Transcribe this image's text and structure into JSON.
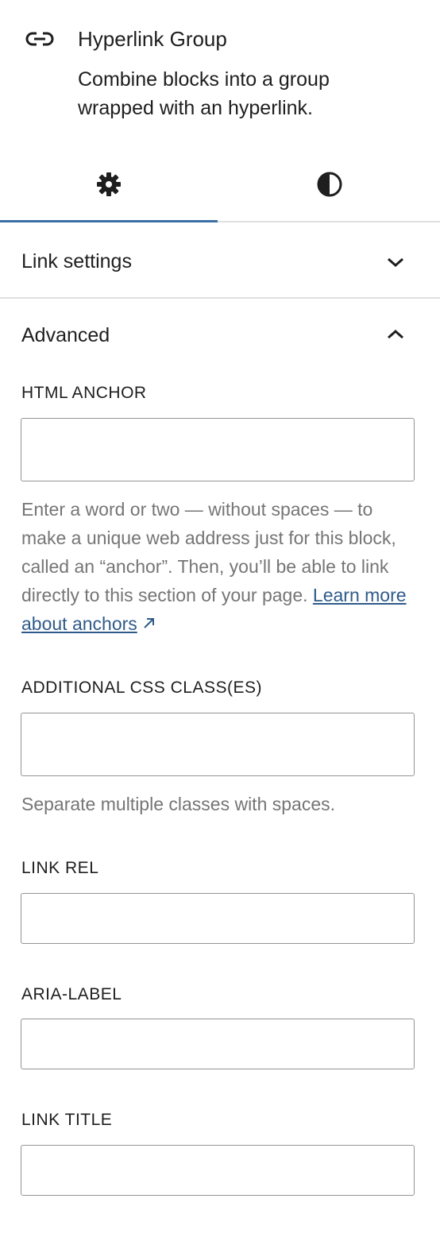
{
  "block": {
    "icon": "link-icon",
    "title": "Hyperlink Group",
    "description": "Combine blocks into a group wrapped with an hyperlink."
  },
  "tabs": [
    {
      "icon": "gear-icon",
      "selected": true
    },
    {
      "icon": "contrast-icon",
      "selected": false
    }
  ],
  "panels": {
    "link_settings": {
      "title": "Link settings",
      "expanded": false
    },
    "advanced": {
      "title": "Advanced",
      "expanded": true
    }
  },
  "fields": {
    "html_anchor": {
      "label": "HTML ANCHOR",
      "value": "",
      "help_prefix": "Enter a word or two — without spaces — to make a unique web address just for this block, called an “anchor”. Then, you’ll be able to link directly to this section of your page. ",
      "help_link": "Learn more about anchors"
    },
    "additional_css": {
      "label": "ADDITIONAL CSS CLASS(ES)",
      "value": "",
      "help": "Separate multiple classes with spaces."
    },
    "link_rel": {
      "label": "LINK REL",
      "value": ""
    },
    "aria_label": {
      "label": "ARIA-LABEL",
      "value": ""
    },
    "link_title": {
      "label": "LINK TITLE",
      "value": ""
    }
  },
  "colors": {
    "accent": "#3a6ea5",
    "link": "#2f5b8a",
    "help_text": "#757575"
  }
}
